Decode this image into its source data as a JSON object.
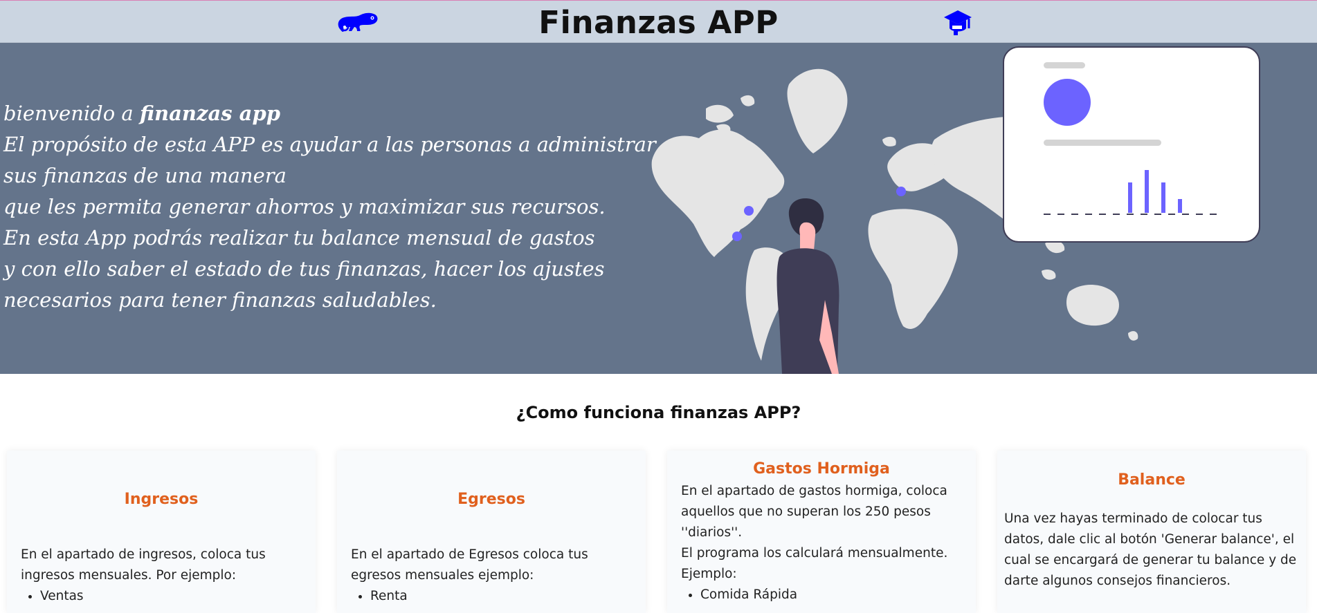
{
  "header": {
    "title": "Finanzas APP",
    "left_icon": "chameleon-icon",
    "right_icon": "graduation-cap-icon",
    "icon_color": "#0000ff"
  },
  "hero": {
    "intro_prefix": "bienvenido a ",
    "intro_app": "finanzas app",
    "lines": [
      "El propósito de esta APP es ayudar a las personas a administrar",
      "sus finanzas de una manera",
      "que les permita generar ahorros y maximizar sus recursos.",
      "En esta App podrás realizar tu balance mensual de gastos",
      "y con ello saber el estado de tus finanzas, hacer los ajustes",
      "necesarios para tener finanzas saludables."
    ],
    "background": "#64748b",
    "accent": "#6c63ff"
  },
  "how": {
    "title": "¿Como funciona finanzas APP?"
  },
  "cards": [
    {
      "title": "Ingresos",
      "paragraphs": [
        "En el apartado de ingresos, coloca tus ingresos mensuales. Por ejemplo:"
      ],
      "items": [
        "Ventas"
      ]
    },
    {
      "title": "Egresos",
      "paragraphs": [
        "En el apartado de Egresos coloca tus egresos mensuales ejemplo:"
      ],
      "items": [
        "Renta"
      ]
    },
    {
      "title": "Gastos Hormiga",
      "paragraphs": [
        "En el apartado de gastos hormiga, coloca aquellos que no superan los 250 pesos ''diarios''.",
        "El programa los calculará mensualmente.",
        "Ejemplo:"
      ],
      "items": [
        "Comida Rápida"
      ]
    },
    {
      "title": "Balance",
      "paragraphs": [
        "Una vez hayas terminado de colocar tus datos, dale clic al botón 'Generar balance', el cual se encargará de generar tu balance y de darte algunos consejos financieros."
      ],
      "items": []
    }
  ],
  "colors": {
    "header_bg": "#cbd5e1",
    "card_title": "#e0601e"
  }
}
